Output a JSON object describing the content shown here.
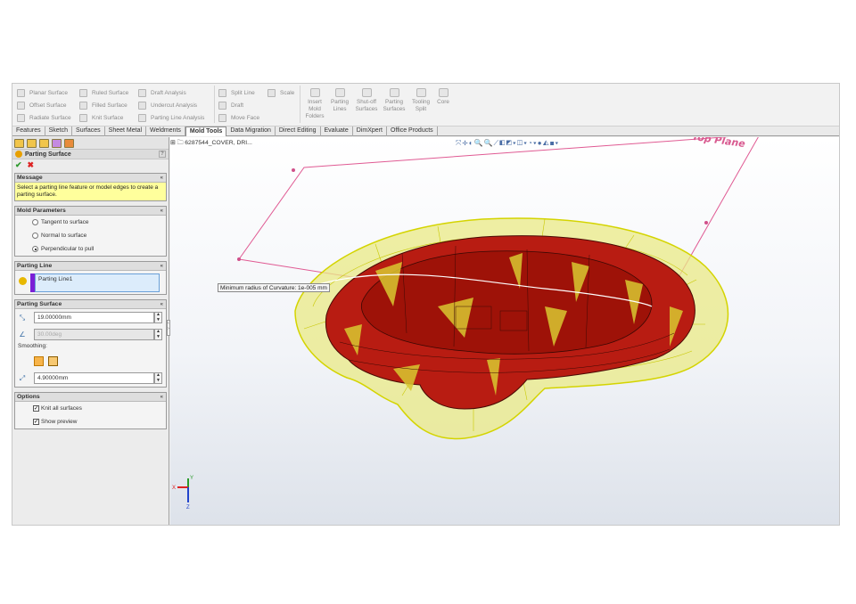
{
  "ribbon": {
    "surfaces_col1": [
      "Planar Surface",
      "Offset Surface",
      "Radiate Surface"
    ],
    "surfaces_col2": [
      "Ruled Surface",
      "Filled Surface",
      "Knit Surface"
    ],
    "analysis_col": [
      "Draft Analysis",
      "Undercut Analysis",
      "Parting Line Analysis"
    ],
    "split_col": [
      "Split Line",
      "Draft",
      "Move Face"
    ],
    "scale_label": "Scale",
    "big_buttons": [
      {
        "label": "Insert Mold Folders"
      },
      {
        "label": "Parting Lines"
      },
      {
        "label": "Shut-off Surfaces"
      },
      {
        "label": "Parting Surfaces"
      },
      {
        "label": "Tooling Split"
      },
      {
        "label": "Core"
      }
    ]
  },
  "tabs": [
    "Features",
    "Sketch",
    "Surfaces",
    "Sheet Metal",
    "Weldments",
    "Mold Tools",
    "Data Migration",
    "Direct Editing",
    "Evaluate",
    "DimXpert",
    "Office Products"
  ],
  "active_tab": "Mold Tools",
  "property_manager": {
    "title": "Parting Surface",
    "message_header": "Message",
    "message_text": "Select a parting line feature or model edges to create a parting surface.",
    "mold_params_header": "Mold Parameters",
    "mold_params": [
      {
        "label": "Tangent to surface",
        "selected": false
      },
      {
        "label": "Normal to surface",
        "selected": false
      },
      {
        "label": "Perpendicular to pull",
        "selected": true
      }
    ],
    "parting_line_header": "Parting Line",
    "parting_line_item": "Parting Line1",
    "parting_surface_header": "Parting Surface",
    "distance_value": "19.00000mm",
    "angle_value": "30.00deg",
    "smoothing_label": "Smoothing:",
    "smoothing_value": "4.90000mm",
    "options_header": "Options",
    "options": [
      {
        "label": "Knit all surfaces",
        "checked": true
      },
      {
        "label": "Show preview",
        "checked": true
      }
    ]
  },
  "viewport": {
    "tree_label": "6287544_COVER, DRI...",
    "plane_label": "Top Plane",
    "tooltip": "Minimum radius of Curvature: 1e-005 mm",
    "triad_axes": [
      "Y",
      "X",
      "Z"
    ]
  },
  "colors": {
    "model_red": "#b81c12",
    "surface_yellow": "#e8e860",
    "plane_pink": "#e05a93"
  }
}
